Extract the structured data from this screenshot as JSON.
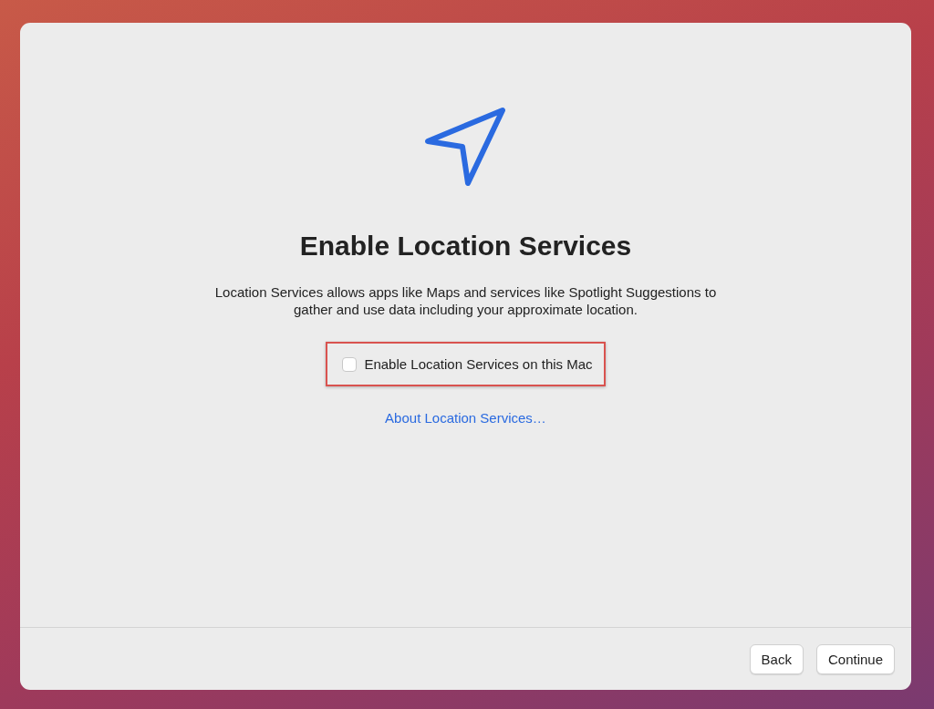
{
  "dialog": {
    "title": "Enable Location Services",
    "description": "Location Services allows apps like Maps and services like Spotlight Suggestions to gather and use data including your approximate location.",
    "option": {
      "label": "Enable Location Services on this Mac",
      "checked": false,
      "highlighted": true
    },
    "link": "About Location Services…",
    "buttons": [
      {
        "label": "Back"
      },
      {
        "label": "Continue"
      }
    ]
  }
}
